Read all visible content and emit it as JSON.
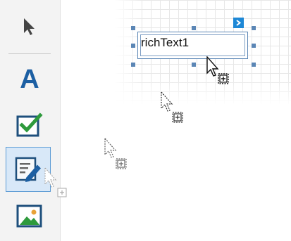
{
  "toolbox": {
    "items": [
      {
        "name": "pointer",
        "icon": "arrow-pointer-icon"
      },
      {
        "name": "label",
        "icon": "text-a-icon",
        "glyph": "A"
      },
      {
        "name": "checkbox",
        "icon": "checkbox-icon"
      },
      {
        "name": "rich-text",
        "icon": "rich-text-edit-icon",
        "selected": true
      },
      {
        "name": "picture",
        "icon": "picture-icon"
      }
    ]
  },
  "designer": {
    "control_text": "richText1",
    "smart_tag_glyph": ">"
  },
  "colors": {
    "accent": "#1c5fa3",
    "selection": "#5b86b5",
    "check": "#2e9a3c",
    "smart_tag": "#1e88d6"
  }
}
